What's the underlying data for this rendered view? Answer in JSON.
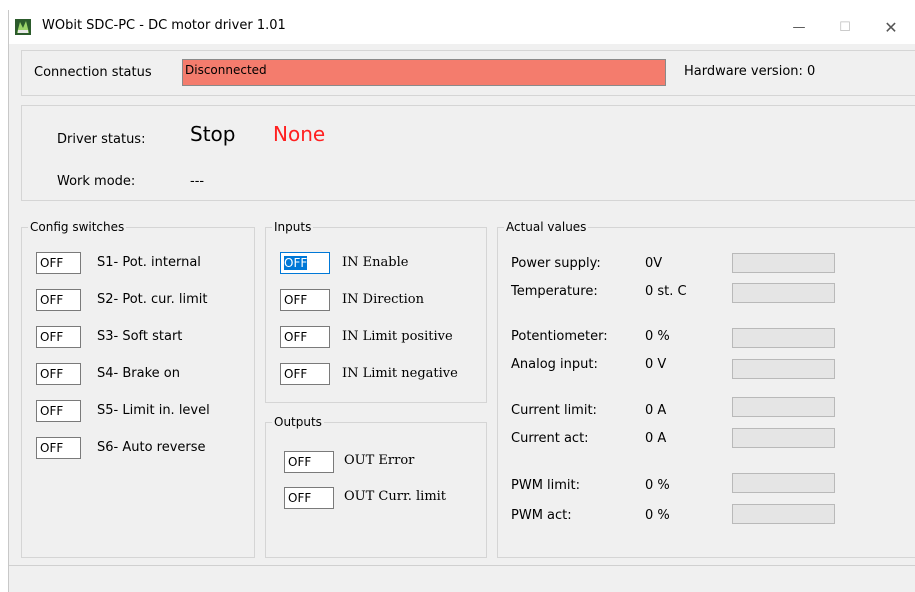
{
  "window": {
    "title": "WObit SDC-PC - DC motor driver  1.01",
    "minimize_glyph": "—",
    "maximize_glyph": "☐",
    "close_glyph": "✕"
  },
  "connection": {
    "label": "Connection status",
    "value": "Disconnected",
    "value_color": "#f47c6d",
    "hardware_version_label": "Hardware version: 0"
  },
  "driver": {
    "status_label": "Driver status:",
    "status_value": "Stop",
    "status_extra": "None",
    "status_extra_color": "#ff2020",
    "work_mode_label": "Work mode:",
    "work_mode_value": "---"
  },
  "config_switches": {
    "title": "Config switches",
    "items": [
      {
        "state": "OFF",
        "label": "S1- Pot. internal"
      },
      {
        "state": "OFF",
        "label": "S2- Pot. cur. limit"
      },
      {
        "state": "OFF",
        "label": "S3- Soft start"
      },
      {
        "state": "OFF",
        "label": "S4- Brake on"
      },
      {
        "state": "OFF",
        "label": "S5- Limit in. level"
      },
      {
        "state": "OFF",
        "label": "S6- Auto reverse"
      }
    ]
  },
  "inputs": {
    "title": "Inputs",
    "items": [
      {
        "state": "OFF",
        "label": "IN Enable"
      },
      {
        "state": "OFF",
        "label": "IN Direction"
      },
      {
        "state": "OFF",
        "label": "IN Limit positive"
      },
      {
        "state": "OFF",
        "label": "IN Limit negative"
      }
    ]
  },
  "outputs": {
    "title": "Outputs",
    "items": [
      {
        "state": "OFF",
        "label": "OUT Error"
      },
      {
        "state": "OFF",
        "label": "OUT Curr. limit"
      }
    ]
  },
  "actual_values": {
    "title": "Actual values",
    "items": [
      {
        "label": "Power supply:",
        "value": "0V"
      },
      {
        "label": "Temperature:",
        "value": "0 st. C"
      },
      {
        "label": "Potentiometer:",
        "value": "0 %"
      },
      {
        "label": "Analog  input:",
        "value": "0 V"
      },
      {
        "label": "Current limit:",
        "value": "0 A"
      },
      {
        "label": "Current act:",
        "value": "0 A"
      },
      {
        "label": "PWM limit:",
        "value": "0 %"
      },
      {
        "label": "PWM act:",
        "value": "0 %"
      }
    ]
  }
}
